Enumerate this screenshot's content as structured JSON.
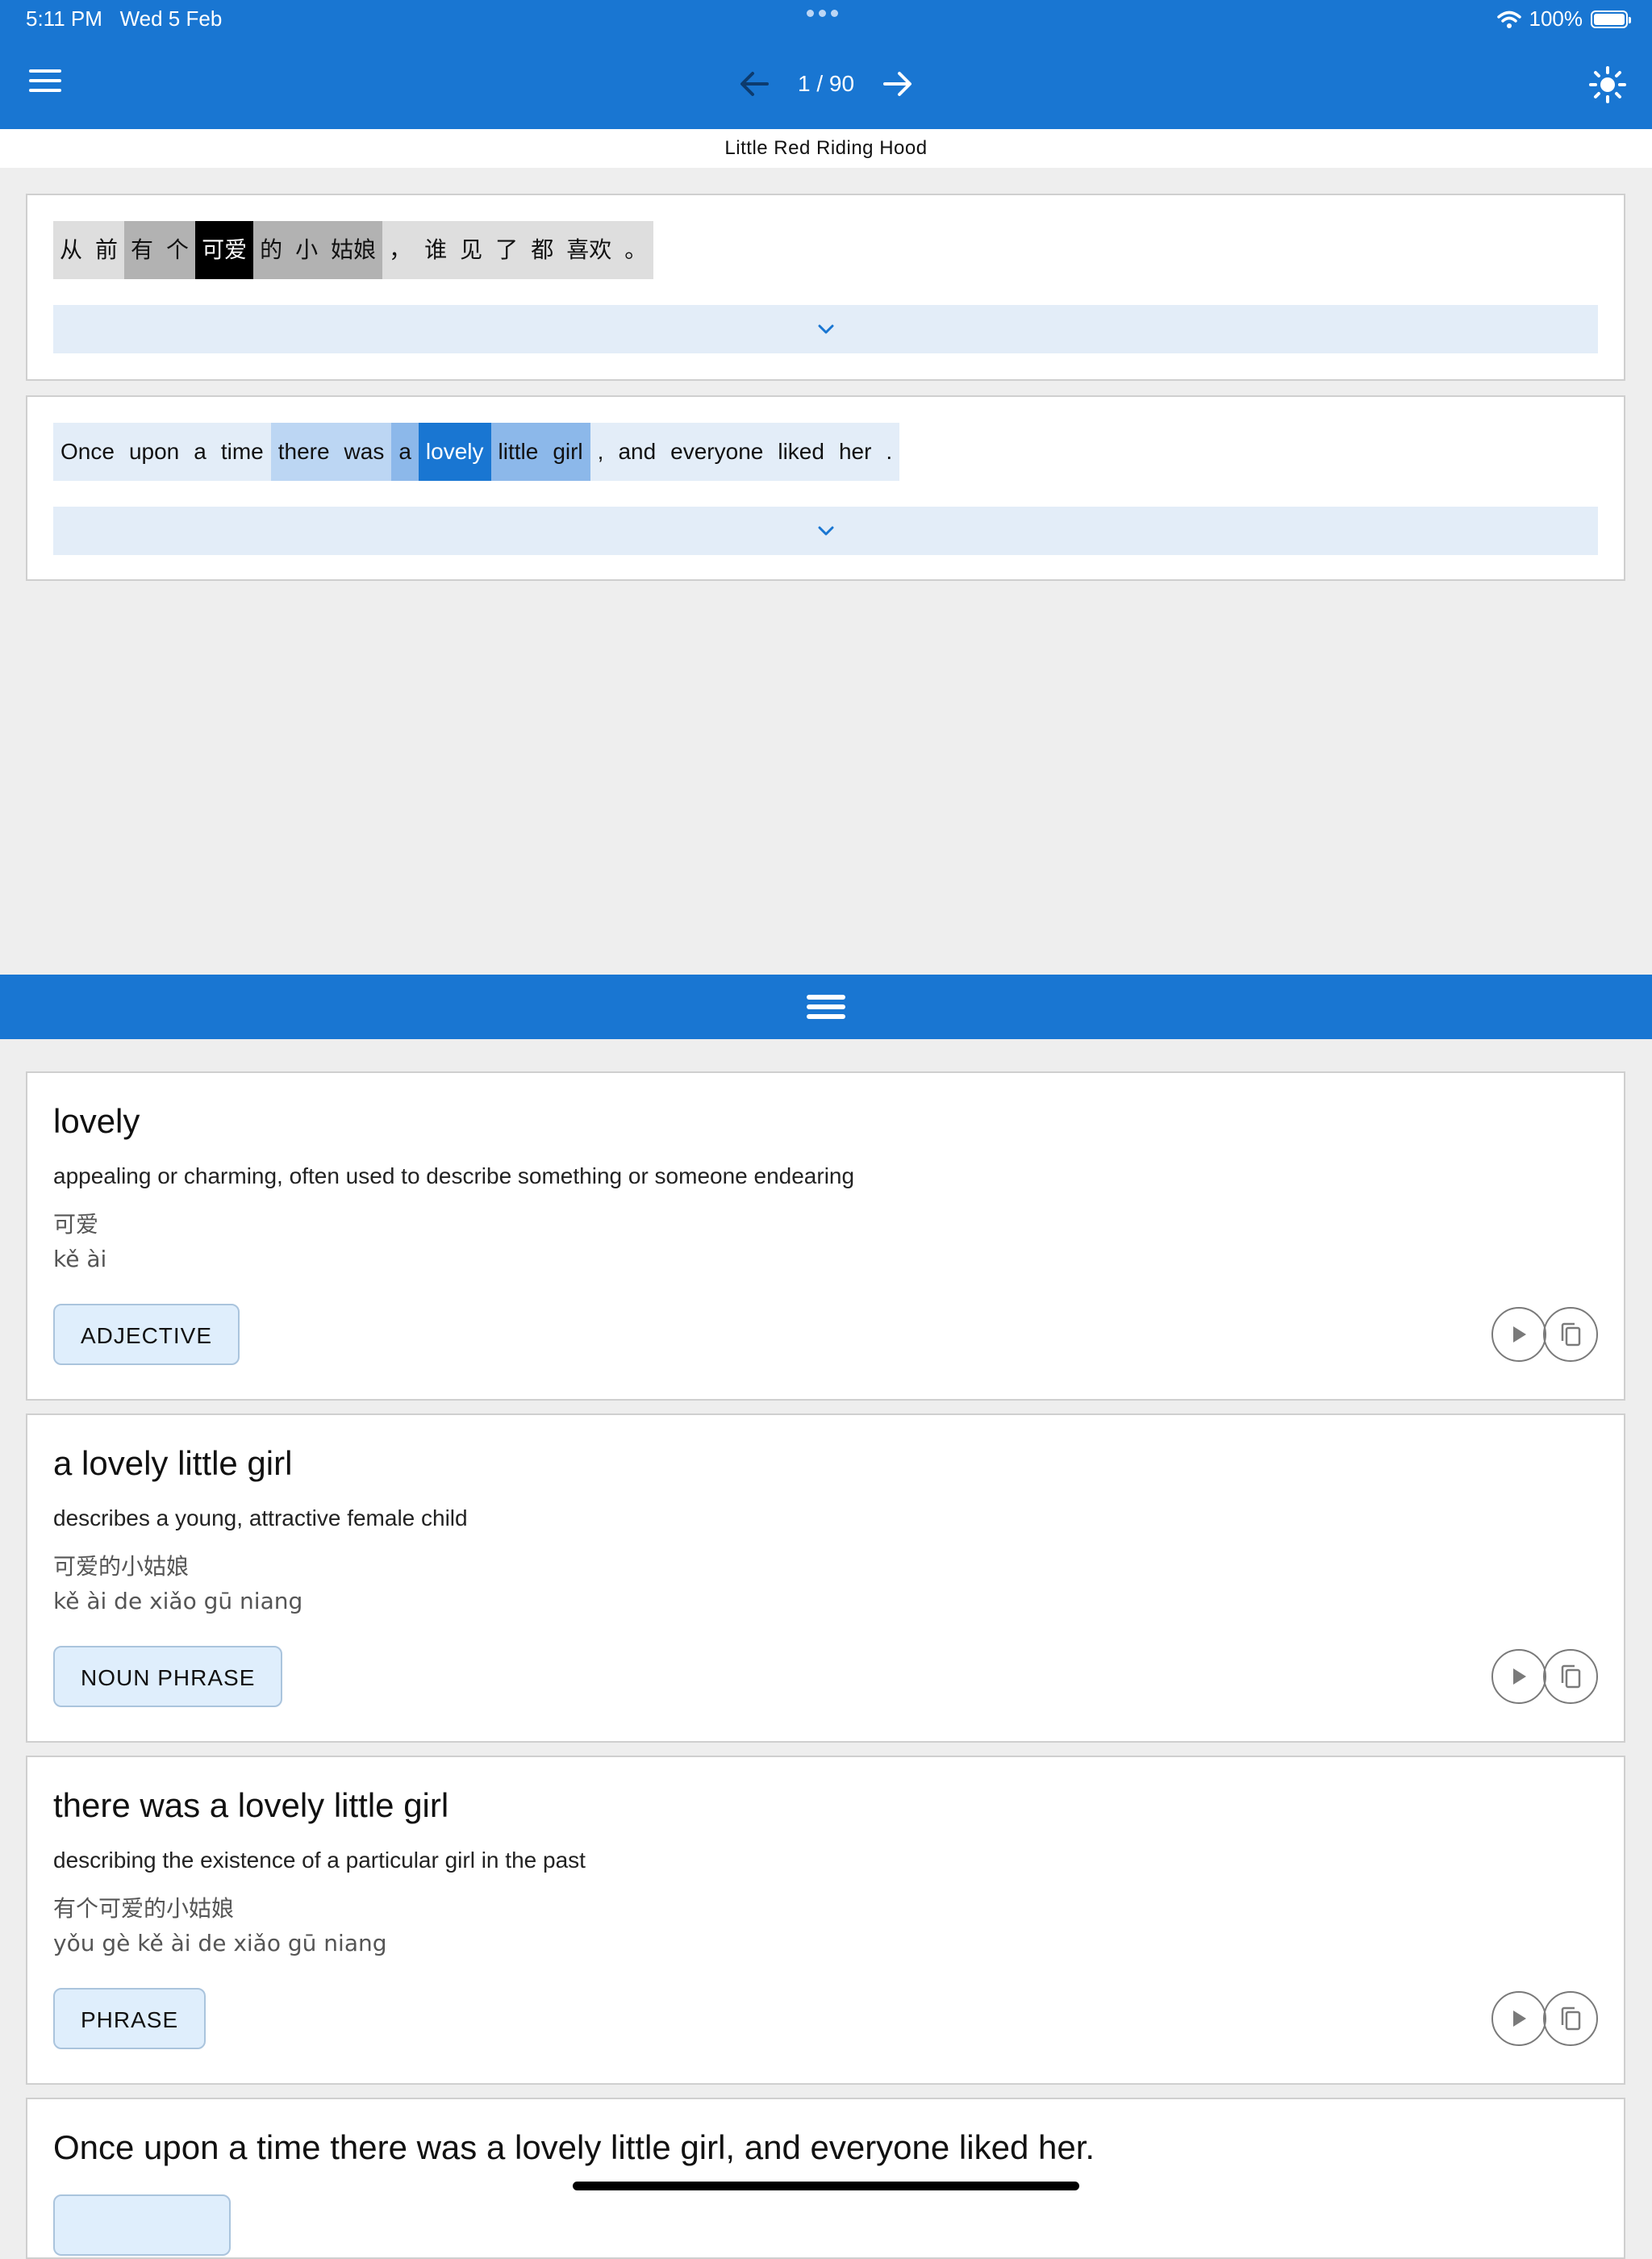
{
  "status_bar": {
    "time": "5:11 PM",
    "date": "Wed 5 Feb",
    "battery_text": "100%",
    "battery_level": 1.0
  },
  "header": {
    "page_indicator": "1 / 90"
  },
  "story_title": "Little Red Riding Hood",
  "chinese_tokens": [
    {
      "text": "从",
      "level": "l1"
    },
    {
      "text": "前",
      "level": "l1"
    },
    {
      "text": "有",
      "level": "l2"
    },
    {
      "text": "个",
      "level": "l2"
    },
    {
      "text": "可爱",
      "level": "sel"
    },
    {
      "text": "的",
      "level": "l2"
    },
    {
      "text": "小",
      "level": "l2"
    },
    {
      "text": "姑娘",
      "level": "l2"
    },
    {
      "text": "，",
      "level": "l1"
    },
    {
      "text": "谁",
      "level": "l1"
    },
    {
      "text": "见",
      "level": "l1"
    },
    {
      "text": "了",
      "level": "l1"
    },
    {
      "text": "都",
      "level": "l1"
    },
    {
      "text": "喜欢",
      "level": "l1"
    },
    {
      "text": "。",
      "level": "l1"
    }
  ],
  "english_tokens": [
    {
      "text": "Once",
      "level": "l1"
    },
    {
      "text": "upon",
      "level": "l1"
    },
    {
      "text": "a",
      "level": "l1"
    },
    {
      "text": "time",
      "level": "l1"
    },
    {
      "text": "there",
      "level": "l2"
    },
    {
      "text": "was",
      "level": "l2"
    },
    {
      "text": "a",
      "level": "l3"
    },
    {
      "text": "lovely",
      "level": "sel"
    },
    {
      "text": "little",
      "level": "l3"
    },
    {
      "text": "girl",
      "level": "l3"
    },
    {
      "text": ",",
      "level": "l1"
    },
    {
      "text": "and",
      "level": "l1"
    },
    {
      "text": "everyone",
      "level": "l1"
    },
    {
      "text": "liked",
      "level": "l1"
    },
    {
      "text": "her",
      "level": "l1"
    },
    {
      "text": ".",
      "level": "l1"
    }
  ],
  "highlight_colors": {
    "zh": {
      "l1": "#dedede",
      "l2": "#b2b2b2",
      "sel": "#000000"
    },
    "en": {
      "l1": "#e3edf8",
      "l2": "#bcd6f3",
      "l3": "#8cb8ea",
      "sel": "#1976d2"
    },
    "accent": "#1976d2"
  },
  "definitions": [
    {
      "headword": "lovely",
      "description": "appealing or charming, often used to describe something or someone endearing",
      "chinese": "可爱",
      "pinyin": "kě ài",
      "pos": "ADJECTIVE"
    },
    {
      "headword": "a lovely little girl",
      "description": "describes a young, attractive female child",
      "chinese": "可爱的小姑娘",
      "pinyin": "kě ài de xiǎo gū niang",
      "pos": "NOUN PHRASE"
    },
    {
      "headword": "there was a lovely little girl",
      "description": "describing the existence of a particular girl in the past",
      "chinese": "有个可爱的小姑娘",
      "pinyin": "yǒu gè kě ài de xiǎo gū niang",
      "pos": "PHRASE"
    },
    {
      "headword": "Once upon a time there was a lovely little girl, and everyone liked her.",
      "description": "",
      "chinese": "",
      "pinyin": "",
      "pos": ""
    }
  ],
  "icons": {
    "menu": "menu-icon",
    "back": "arrow-left-icon",
    "forward": "arrow-right-icon",
    "theme": "sun-icon",
    "expand": "chevron-down-icon",
    "play": "play-icon",
    "copy": "copy-icon",
    "divider": "drag-handle-icon"
  }
}
